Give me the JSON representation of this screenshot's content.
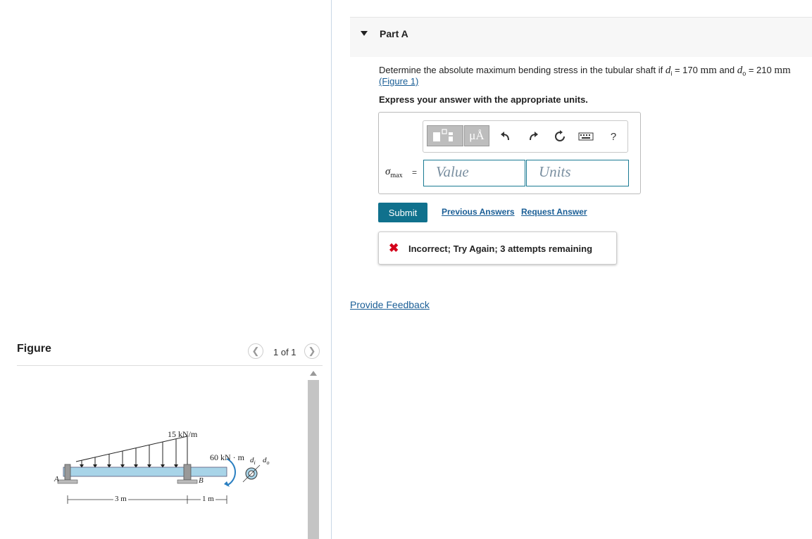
{
  "figure_panel": {
    "heading": "Figure",
    "pager": {
      "prev_icon": "chevron-left-icon",
      "next_icon": "chevron-right-icon",
      "text": "1 of 1"
    },
    "diagram": {
      "load_label": "15 kN/m",
      "moment_label": "60 kN · m",
      "point_a": "A",
      "point_b": "B",
      "dim_1": "3 m",
      "dim_2": "1 m",
      "inner_d": "d",
      "inner_d_sub": "i",
      "outer_d": "d",
      "outer_d_sub": "o"
    }
  },
  "part": {
    "title": "Part A",
    "question": {
      "text_before": "Determine the absolute maximum bending stress in the tubular shaft if ",
      "var1": "d",
      "var1_sub": "i",
      "eq1": " = 170 ",
      "unit1": "mm",
      "and_text": " and ",
      "var2": "d",
      "var2_sub": "o",
      "eq2": " = 210 ",
      "unit2": "mm"
    },
    "figure_link": "(Figure 1)",
    "instruction": "Express your answer with the appropriate units.",
    "toolbar": {
      "units_label": "μÅ",
      "help_label": "?",
      "icons": [
        "templates-icon",
        "units-icon",
        "undo-icon",
        "redo-icon",
        "reset-icon",
        "keyboard-icon",
        "help-icon"
      ]
    },
    "answer": {
      "symbol": "σ",
      "symbol_sub": "max",
      "equals": "=",
      "value_placeholder": "Value",
      "units_placeholder": "Units"
    },
    "submit_label": "Submit",
    "previous_answers_label": "Previous Answers",
    "request_answer_label": "Request Answer",
    "feedback": {
      "icon": "x-icon",
      "text": "Incorrect; Try Again; 3 attempts remaining",
      "color": "#d4001a"
    }
  },
  "provide_feedback_label": "Provide Feedback",
  "colors": {
    "accent": "#10718d",
    "link": "#1a5e96",
    "error": "#d4001a"
  }
}
